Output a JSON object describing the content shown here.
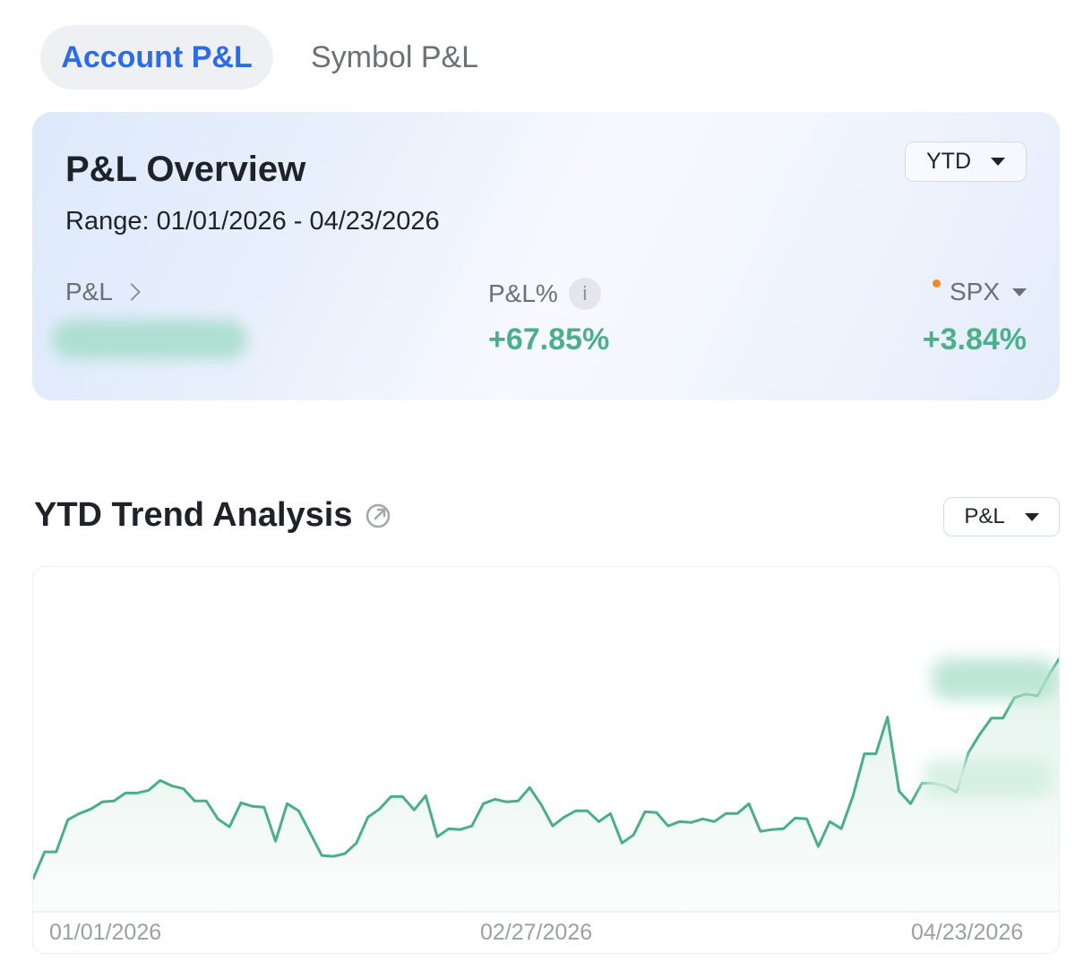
{
  "tabs": [
    {
      "label": "Account P&L",
      "active": true
    },
    {
      "label": "Symbol P&L",
      "active": false
    }
  ],
  "overview": {
    "title": "P&L Overview",
    "range_label": "Range:",
    "range_value": "01/01/2026 - 04/23/2026",
    "period_selector": "YTD",
    "pl_label": "P&L",
    "pl_value_hidden": true,
    "pct_label": "P&L%",
    "info_icon": "i",
    "pct_value": "+67.85%",
    "benchmark_label": "SPX",
    "benchmark_value": "+3.84%"
  },
  "trend": {
    "title": "YTD Trend Analysis",
    "metric_selector": "P&L"
  },
  "colors": {
    "accent_blue": "#2e6be6",
    "positive_green": "#4caf89",
    "line_green": "#4aaf85",
    "benchmark_dot": "#f08a24",
    "muted_text": "#6b6f76",
    "axis_text": "#9aa0a6"
  },
  "icons": {
    "pl_chevron": "chevron-right-icon",
    "info": "info-icon",
    "period_caret": "caret-down-icon",
    "benchmark_caret": "caret-down-icon",
    "share": "share-icon",
    "metric_caret": "caret-down-icon"
  },
  "chart_data": {
    "type": "area",
    "x_tick_labels": [
      "01/01/2026",
      "02/27/2026",
      "04/23/2026"
    ],
    "y_axis_hidden": true,
    "series": [
      {
        "values": [
          0,
          30,
          30,
          66,
          73,
          78,
          86,
          87,
          96,
          96,
          99,
          110,
          104,
          101,
          87,
          87,
          67,
          58,
          85,
          81,
          80,
          42,
          84,
          76,
          51,
          26,
          25,
          28,
          40,
          69,
          78,
          92,
          92,
          77,
          93,
          47,
          56,
          55,
          59,
          84,
          89,
          86,
          87,
          102,
          83,
          59,
          69,
          76,
          76,
          64,
          73,
          40,
          49,
          75,
          74,
          59,
          64,
          63,
          67,
          64,
          73,
          73,
          84,
          53,
          55,
          56,
          68,
          67,
          36,
          64,
          56,
          92,
          140,
          140,
          181,
          98,
          84,
          107,
          107,
          104,
          97,
          141,
          162,
          180,
          180,
          203,
          207,
          205,
          229,
          249
        ]
      }
    ]
  }
}
